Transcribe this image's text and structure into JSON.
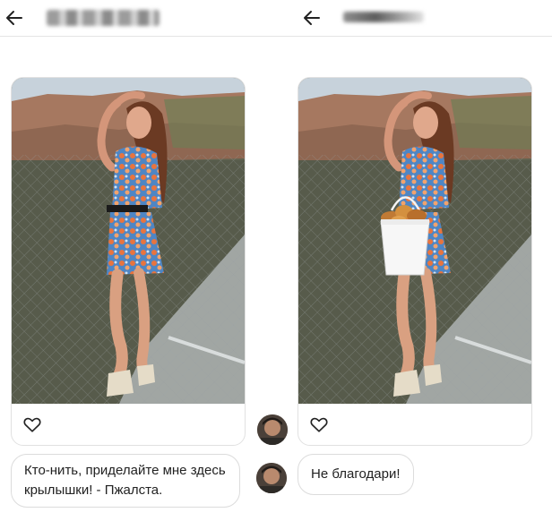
{
  "left": {
    "header": {
      "title_blurred": true
    },
    "message": "Кто-нить, приделайте мне здесь крылышки! - Пжалста."
  },
  "right": {
    "header": {
      "title_blurred": true
    },
    "message": "Не благодари!"
  },
  "icons": {
    "back": "arrow-left-icon",
    "like": "heart-icon"
  },
  "colors": {
    "header_bg": "#ffffff",
    "bubble_border": "#dcdcdc",
    "text": "#222222",
    "sky": "#c9d3dc",
    "water": "#585b4a"
  }
}
